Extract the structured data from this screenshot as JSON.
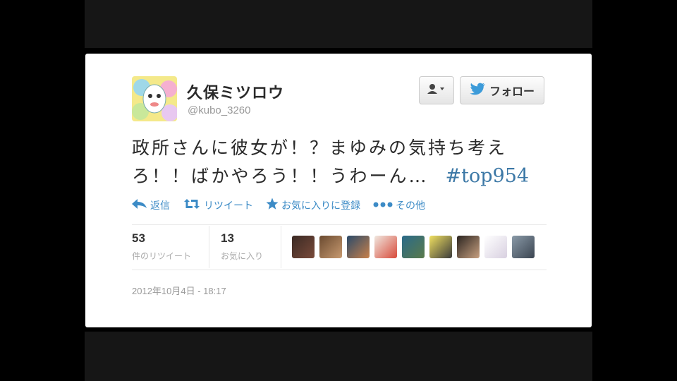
{
  "profile": {
    "name": "久保ミツロウ",
    "handle": "@kubo_3260",
    "avatar_icon": "profile-avatar-illustration"
  },
  "buttons": {
    "user_menu_icon": "user-dropdown-icon",
    "follow_label": "フォロー",
    "follow_icon": "twitter-bird-icon"
  },
  "tweet": {
    "text": "政所さんに彼女が！？まゆみの気持ち考えろ！！ばかやろう！！うわーん…",
    "hashtag": "#top954"
  },
  "actions": [
    {
      "label": "返信",
      "icon": "reply-arrow-icon"
    },
    {
      "label": "リツイート",
      "icon": "retweet-icon"
    },
    {
      "label": "お気に入りに登録",
      "icon": "star-icon"
    },
    {
      "label": "その他",
      "icon": "more-dots-icon"
    }
  ],
  "stats": {
    "retweets": {
      "count": "53",
      "label": "件のリツイート"
    },
    "favorites": {
      "count": "13",
      "label": "お気に入り"
    }
  },
  "engaged_users_count": 9,
  "timestamp": "2012年10月4日 - 18:17",
  "colors": {
    "link_blue": "#3c8bc6",
    "hashtag_blue": "#3c78a6",
    "text_dark": "#2a2a2a",
    "muted_gray": "#999999"
  }
}
